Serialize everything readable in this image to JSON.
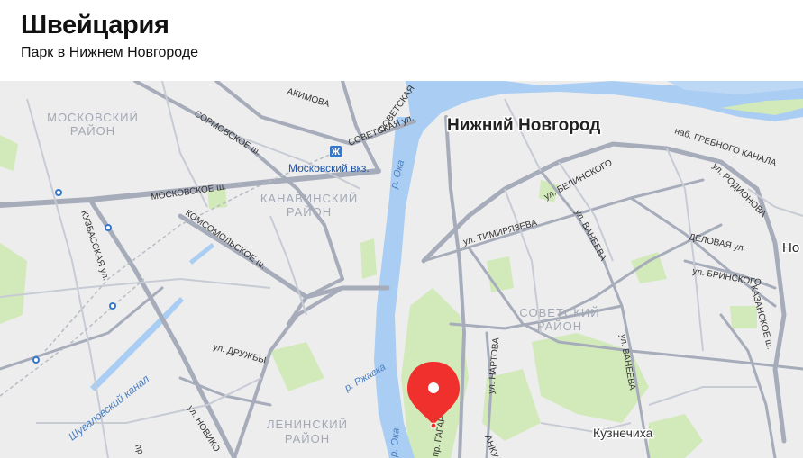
{
  "header": {
    "title": "Швейцария",
    "subtitle": "Парк в Нижнем Новгороде"
  },
  "map": {
    "labels": {
      "city": "Нижний Новгород",
      "city_edge": "Но",
      "district_moskovsky_1": "МОСКОВСКИЙ",
      "district_moskovsky_2": "РАЙОН",
      "district_kanavinsky_1": "КАНАВИНСКИЙ",
      "district_kanavinsky_2": "РАЙОН",
      "district_sovetsky_1": "СОВЕТСКИЙ",
      "district_sovetsky_2": "РАЙОН",
      "district_leninsky_1": "ЛЕНИНСКИЙ",
      "district_leninsky_2": "РАЙОН",
      "station": "Московский вкз.",
      "river_oka_1": "р. Ока",
      "river_oka_2": "р. Ока",
      "river_rzhavka": "р. Ржавка",
      "canal_shuvalovsky": "Шуваловский канал",
      "kuznechikha": "Кузнечиха",
      "street_akimova": "АКИМОВА",
      "street_sovetskaya_1": "СОВЕТСКАЯ",
      "street_sovetskaya_2": "СОВЕТСКАЯ ул.",
      "street_sormovskoe": "СОРМОВСКОЕ ш.",
      "street_moskovskoe": "МОСКОВСКОЕ ш.",
      "street_kuzubasskaya": "КУЗБАССКАЯ ул.",
      "street_komsomolskoe": "КОМСОМОЛЬСКОЕ ш.",
      "street_druzhby": "ул. ДРУЖБЫ",
      "street_novikova": "ул. НОВИКО",
      "street_pro": "пр",
      "street_timiryazeva": "ул. ТИМИРЯЗЕВА",
      "street_belinskogo": "ул. БЕЛИНСКОГО",
      "street_vaneeva_1": "ул. ВАНЕЕВА",
      "street_vaneeva_2": "ул. ВАНЕЕВА",
      "street_grebnogo": "наб. ГРЕБНОГО КАНАЛА",
      "street_rodionova": "ул. РОДИОНОВА",
      "street_delovaya": "ДЕЛОВАЯ ул.",
      "street_brinskogo": "ул. БРИНСКОГО",
      "street_kazanskoe": "КАЗАНСКОЕ ш.",
      "street_nartova": "ул. НАРТОВА",
      "street_gagarina": "пр. ГАГАР",
      "street_ankud": "АНКУ"
    },
    "colors": {
      "water": "#a9cdf3",
      "park": "#cfe8b6",
      "road": "#a8aebd",
      "pin": "#f0302c"
    }
  }
}
